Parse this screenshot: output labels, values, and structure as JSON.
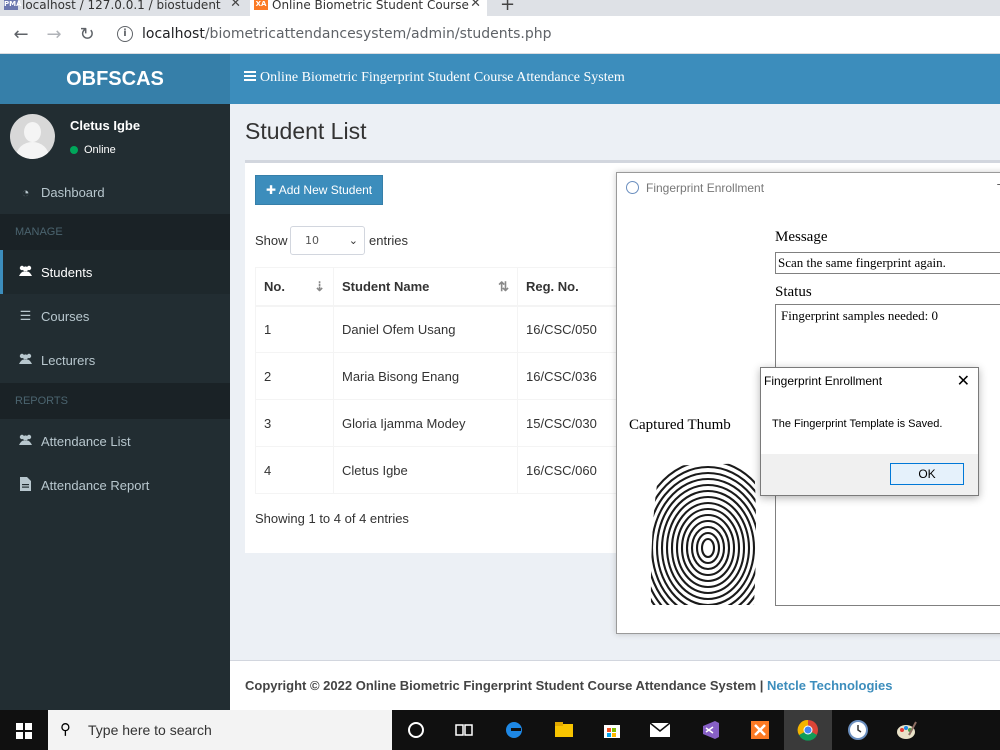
{
  "browser": {
    "tabs": [
      {
        "title": "localhost / 127.0.0.1 / biostudent",
        "favicon": "PMA"
      },
      {
        "title": "Online Biometric Student Course",
        "favicon": "XA"
      }
    ],
    "url_host": "localhost",
    "url_path": "/biometricattendancesystem/admin/students.php"
  },
  "header": {
    "logo": "OBFSCAS",
    "title": "Online Biometric Fingerprint Student Course Attendance System"
  },
  "user": {
    "name": "Cletus Igbe",
    "status": "Online"
  },
  "sidebar": {
    "dashboard": "Dashboard",
    "manage_header": "MANAGE",
    "students": "Students",
    "courses": "Courses",
    "lecturers": "Lecturers",
    "reports_header": "REPORTS",
    "attendance_list": "Attendance List",
    "attendance_report": "Attendance Report"
  },
  "page": {
    "title": "Student List",
    "add_button": "Add New Student",
    "show_label": "Show",
    "entries_label": "entries",
    "entries_value": "10",
    "info": "Showing 1 to 4 of 4 entries"
  },
  "table": {
    "headers": [
      "No.",
      "Student Name",
      "Reg. No."
    ],
    "rows": [
      [
        "1",
        "Daniel Ofem Usang",
        "16/CSC/050"
      ],
      [
        "2",
        "Maria Bisong Enang",
        "16/CSC/036"
      ],
      [
        "3",
        "Gloria Ijamma Modey",
        "15/CSC/030"
      ],
      [
        "4",
        "Cletus Igbe",
        "16/CSC/060"
      ]
    ]
  },
  "fingerprint_window": {
    "title": "Fingerprint Enrollment",
    "message_label": "Message",
    "message_value": "Scan the same fingerprint again.",
    "status_label": "Status",
    "status_value": "Fingerprint samples needed: 0",
    "captured_label": "Captured Thumb"
  },
  "dialog": {
    "title": "Fingerprint Enrollment",
    "message": "The Fingerprint Template is Saved.",
    "ok": "OK"
  },
  "footer": {
    "text": "Copyright © 2022 Online Biometric Fingerprint Student Course Attendance System | ",
    "company": "Netcle Technologies"
  },
  "taskbar": {
    "search_placeholder": "Type here to search"
  },
  "colors": {
    "header_blue": "#3c8dbc",
    "logo_blue": "#367fa9",
    "sidebar_dark": "#222d32",
    "online_green": "#00a65a"
  }
}
